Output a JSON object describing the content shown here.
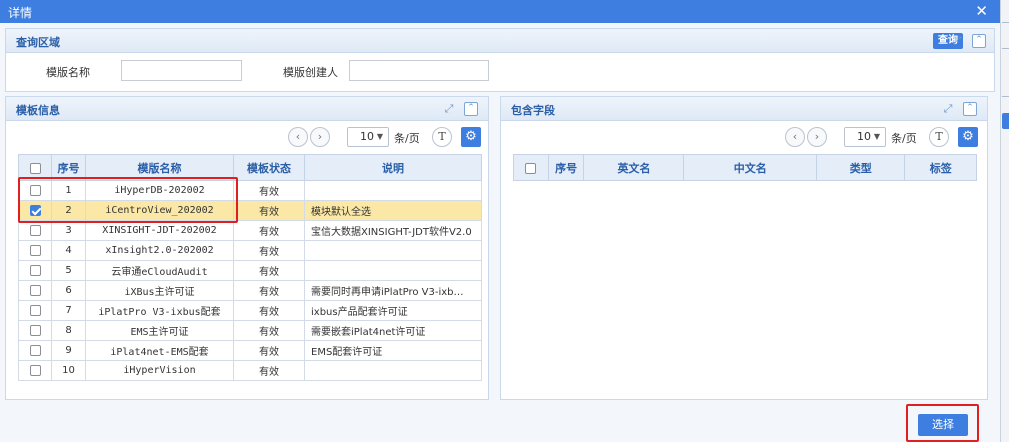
{
  "window": {
    "title": "详情",
    "close_icon": "close-icon"
  },
  "query_panel": {
    "title": "查询区域",
    "query_button": "查询",
    "fields": [
      {
        "label": "模版名称",
        "value": ""
      },
      {
        "label": "模版创建人",
        "value": ""
      }
    ]
  },
  "template_panel": {
    "title": "模板信息",
    "pager": {
      "page_size": "10",
      "unit": "条/页",
      "text_button": "T"
    },
    "columns": [
      "序号",
      "模版名称",
      "模板状态",
      "说明"
    ],
    "rows": [
      {
        "no": "1",
        "name": "iHyperDB-202002",
        "status": "有效",
        "desc": "",
        "checked": false
      },
      {
        "no": "2",
        "name": "iCentroView_202002",
        "status": "有效",
        "desc": "模块默认全选",
        "checked": true
      },
      {
        "no": "3",
        "name": "XINSIGHT-JDT-202002",
        "status": "有效",
        "desc": "宝信大数据XINSIGHT-JDT软件V2.0",
        "checked": false
      },
      {
        "no": "4",
        "name": "xInsight2.0-202002",
        "status": "有效",
        "desc": "",
        "checked": false
      },
      {
        "no": "5",
        "name": "云审通eCloudAudit",
        "status": "有效",
        "desc": "",
        "checked": false
      },
      {
        "no": "6",
        "name": "iXBus主许可证",
        "status": "有效",
        "desc": "需要同时再申请iPlatPro V3-ixb…",
        "checked": false
      },
      {
        "no": "7",
        "name": "iPlatPro V3-ixbus配套",
        "status": "有效",
        "desc": "ixbus产品配套许可证",
        "checked": false
      },
      {
        "no": "8",
        "name": "EMS主许可证",
        "status": "有效",
        "desc": "需要嵌套iPlat4net许可证",
        "checked": false
      },
      {
        "no": "9",
        "name": "iPlat4net-EMS配套",
        "status": "有效",
        "desc": "EMS配套许可证",
        "checked": false
      },
      {
        "no": "10",
        "name": "iHyperVision",
        "status": "有效",
        "desc": "",
        "checked": false
      }
    ]
  },
  "fields_panel": {
    "title": "包含字段",
    "pager": {
      "page_size": "10",
      "unit": "条/页",
      "text_button": "T"
    },
    "columns": [
      "序号",
      "英文名",
      "中文名",
      "类型",
      "标签"
    ]
  },
  "footer": {
    "select_button": "选择"
  },
  "colors": {
    "accent": "#3d7ee0",
    "highlight_row": "#fbe8a6",
    "annotation_red": "#e02020"
  }
}
